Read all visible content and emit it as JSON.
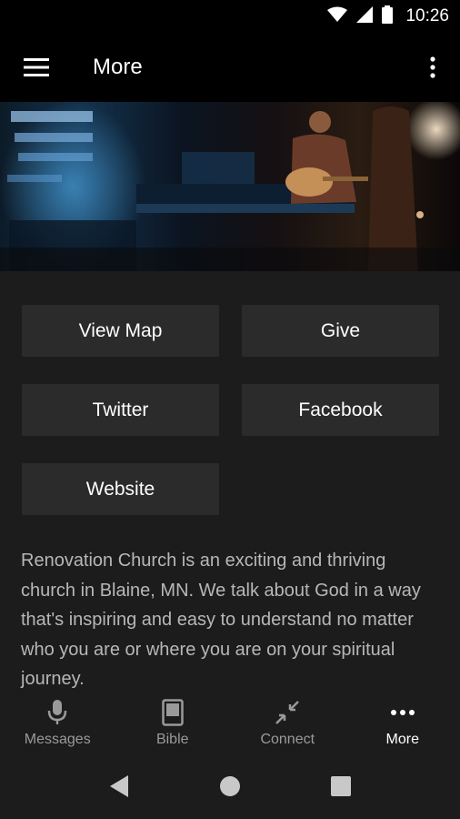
{
  "status_bar": {
    "time": "10:26",
    "icons": [
      "wifi-icon",
      "signal-icon",
      "battery-icon"
    ]
  },
  "app_bar": {
    "title": "More",
    "left_icon": "hamburger-menu-icon",
    "right_icon": "overflow-menu-icon"
  },
  "hero": {
    "description_icon": "hero-image"
  },
  "buttons": {
    "view_map": "View Map",
    "give": "Give",
    "twitter": "Twitter",
    "facebook": "Facebook",
    "website": "Website"
  },
  "description": "Renovation Church is an exciting and thriving church in Blaine, MN. We talk about God in a way that's inspiring and easy to understand no matter who you are or where you are on your spiritual journey.",
  "bottom_nav": {
    "items": [
      {
        "label": "Messages",
        "icon": "microphone-icon",
        "active": false
      },
      {
        "label": "Bible",
        "icon": "book-icon",
        "active": false
      },
      {
        "label": "Connect",
        "icon": "connect-icon",
        "active": false
      },
      {
        "label": "More",
        "icon": "more-dots-icon",
        "active": true
      }
    ]
  },
  "colors": {
    "background": "#000000",
    "content_bg": "#1c1c1c",
    "button_bg": "#2b2b2b",
    "text_primary": "#ffffff",
    "text_secondary": "#b7b7b7",
    "nav_inactive": "#9a9a9a"
  }
}
